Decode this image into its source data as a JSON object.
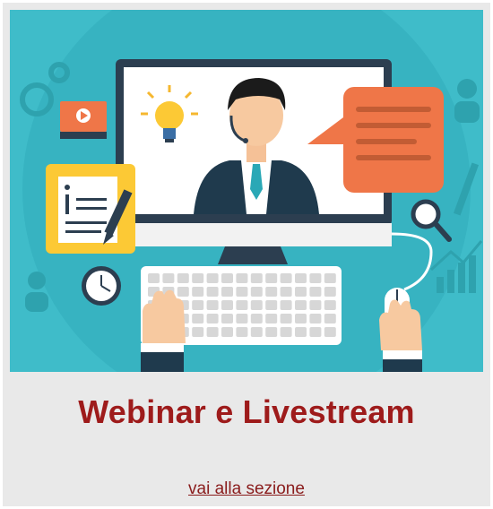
{
  "card": {
    "title": "Webinar e Livestream",
    "link_label": "vai alla sezione",
    "title_color": "#9e1b1b",
    "background_color": "#e9e9e9"
  },
  "illustration": {
    "background_color": "#3fbcc9",
    "icons": [
      "computer-monitor",
      "presenter-avatar",
      "lightbulb-icon",
      "speech-bubble-icon",
      "document-icon",
      "pencil-icon",
      "clock-icon",
      "magnifier-icon",
      "keyboard",
      "mouse-icon",
      "hand-icon",
      "video-player-icon",
      "gear-icon",
      "bar-chart-icon",
      "person-silhouette-icon"
    ]
  }
}
